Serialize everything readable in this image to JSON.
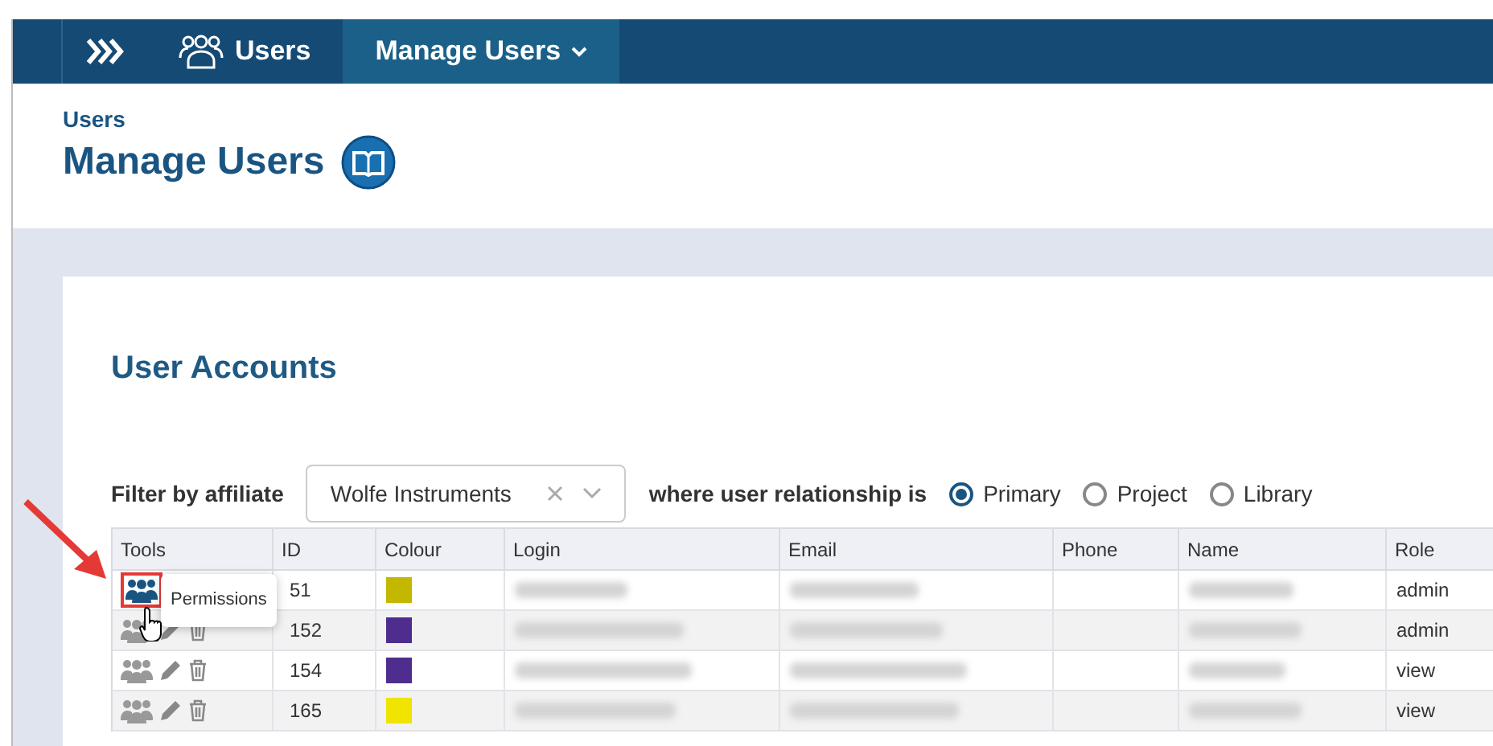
{
  "breadcrumb": [
    {
      "label": "Users",
      "kind": "section"
    },
    {
      "label": "Manage Users",
      "kind": "current"
    }
  ],
  "header": {
    "section": "Users",
    "title": "Manage Users"
  },
  "card": {
    "title": "User Accounts"
  },
  "filter": {
    "label": "Filter by affiliate",
    "value": "Wolfe Instruments",
    "relation_label": "where user relationship is",
    "options": [
      {
        "label": "Primary",
        "selected": true
      },
      {
        "label": "Project",
        "selected": false
      },
      {
        "label": "Library",
        "selected": false
      }
    ]
  },
  "table": {
    "columns": [
      "Tools",
      "ID",
      "Colour",
      "Login",
      "Email",
      "Phone",
      "Name",
      "Role"
    ],
    "rows": [
      {
        "highlighted": true,
        "id": "51",
        "color": "#c4b700",
        "role": "admin"
      },
      {
        "highlighted": false,
        "id": "152",
        "color": "#4f2d8f",
        "role": "admin"
      },
      {
        "highlighted": false,
        "id": "154",
        "color": "#4f2d8f",
        "role": "view"
      },
      {
        "highlighted": false,
        "id": "165",
        "color": "#f0e400",
        "role": "view"
      }
    ]
  },
  "tooltip": {
    "text": "Permissions"
  }
}
